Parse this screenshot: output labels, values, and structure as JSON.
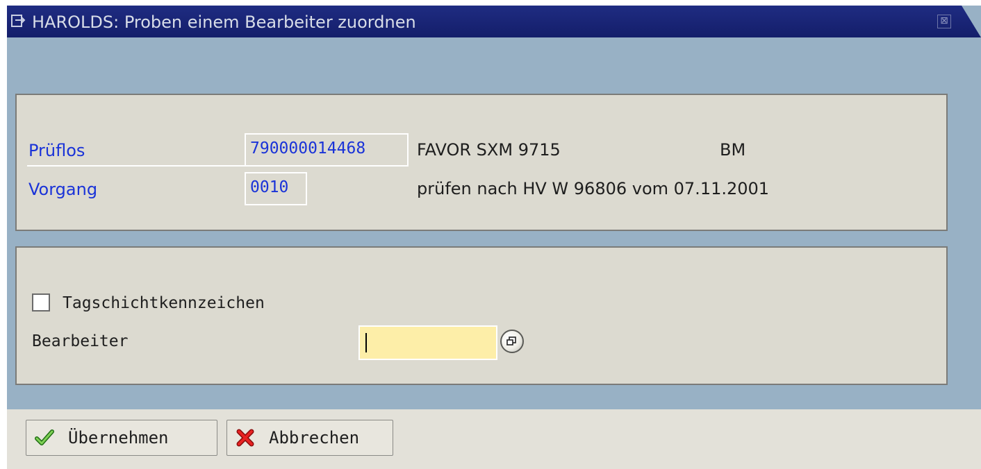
{
  "window": {
    "title": "HAROLDS: Proben einem Bearbeiter zuordnen",
    "close_glyph": "⊠",
    "title_icon": "dialog-arrow-icon",
    "close_icon": "close-icon"
  },
  "header_group": {
    "prueflos": {
      "label": "Prüflos",
      "value": "790000014468",
      "text": "FAVOR SXM 9715",
      "extra": "BM"
    },
    "vorgang": {
      "label": "Vorgang",
      "value": "0010",
      "text": "prüfen nach HV W 96806 vom 07.11.2001"
    }
  },
  "assign_group": {
    "checkbox_label": "Tagschichtkennzeichen",
    "checkbox_checked": false,
    "bearbeiter_label": "Bearbeiter",
    "bearbeiter_value": "",
    "value_help_icon": "value-help-icon"
  },
  "footer": {
    "ok_label": "Übernehmen",
    "ok_icon": "checkmark-icon",
    "cancel_label": "Abbrechen",
    "cancel_icon": "cancel-x-icon"
  },
  "colors": {
    "titlebar": "#1f2c82",
    "background": "#98b1c5",
    "group_bg": "#dcdad0",
    "label_blue": "#1a33d8",
    "input_yellow": "#fdeea8"
  }
}
